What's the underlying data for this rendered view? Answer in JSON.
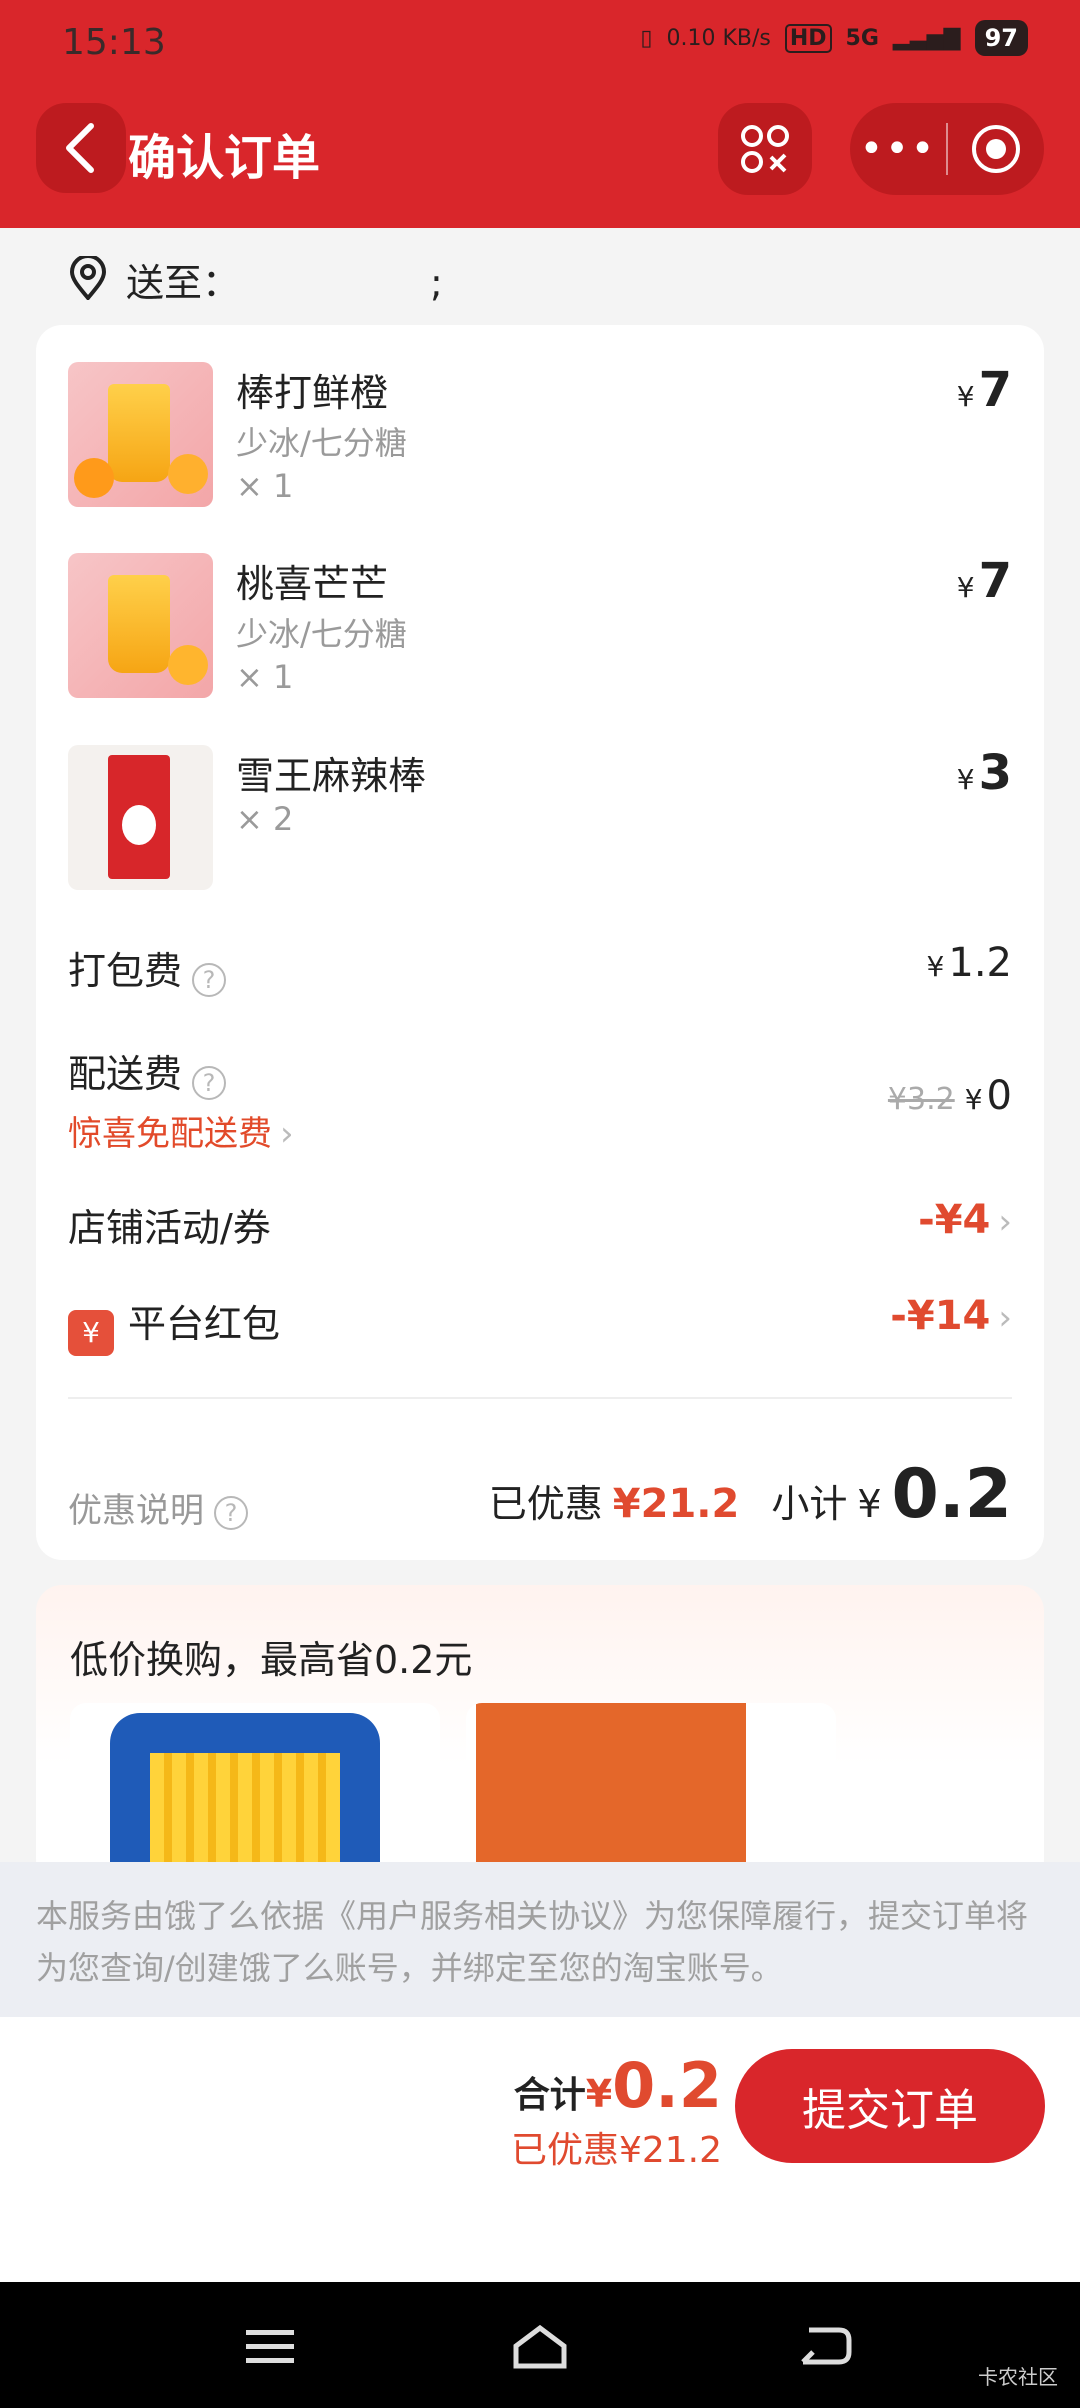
{
  "status_bar": {
    "time": "15:13",
    "net_speed": "0.10 KB/s",
    "hd": "HD",
    "network": "5G",
    "battery": "97"
  },
  "header": {
    "title": "确认订单"
  },
  "address": {
    "label": "送至：",
    "suffix": ";"
  },
  "items": [
    {
      "name": "棒打鲜橙",
      "spec": "少冰/七分糖",
      "qty": "× 1",
      "price": "7"
    },
    {
      "name": "桃喜芒芒",
      "spec": "少冰/七分糖",
      "qty": "× 1",
      "price": "7"
    },
    {
      "name": "雪王麻辣棒",
      "spec": "",
      "qty": "× 2",
      "price": "3"
    }
  ],
  "fees": {
    "packing_label": "打包费",
    "packing_value": "1.2",
    "delivery_label": "配送费",
    "delivery_promo": "惊喜免配送费",
    "delivery_original": "¥3.2",
    "delivery_value": "0",
    "shop_label": "店铺活动/券",
    "shop_value": "-¥4",
    "platform_label": "平台红包",
    "platform_value": "-¥14"
  },
  "summary": {
    "note": "优惠说明",
    "discounted_label": "已优惠",
    "discounted_value": "¥21.2",
    "subtotal_label": "小计",
    "subtotal_yen": "¥",
    "subtotal_value": "0.2"
  },
  "swap": {
    "title": "低价换购，最高省0.2元"
  },
  "notice": {
    "text": "本服务由饿了么依据《用户服务相关协议》为您保障履行，提交订单将为您查询/创建饿了么账号，并绑定至您的淘宝账号。"
  },
  "bottom": {
    "total_label": "合计",
    "total_yen": "¥",
    "total_value": "0.2",
    "saved": "已优惠¥21.2",
    "submit": "提交订单"
  },
  "watermark": "卡农社区",
  "colors": {
    "brand_red": "#d9262b",
    "accent_orange": "#e04a2f"
  },
  "icons": [
    "back-arrow-icon",
    "scan-icon",
    "more-icon",
    "close-target-icon",
    "location-pin-icon",
    "help-icon",
    "chevron-right-icon",
    "red-packet-icon",
    "menu-icon",
    "home-icon",
    "back-icon"
  ]
}
